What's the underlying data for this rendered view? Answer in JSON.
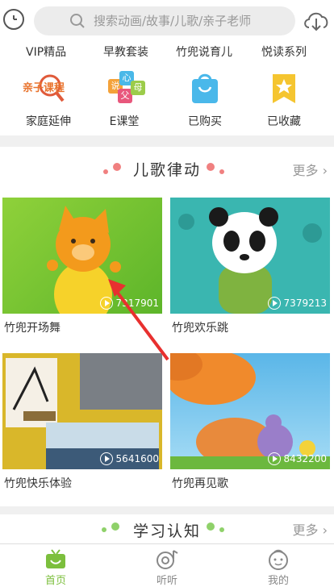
{
  "header": {
    "search_placeholder": "搜索动画/故事/儿歌/亲子老师"
  },
  "menu_top": [
    "VIP精品",
    "早教套装",
    "竹兜说育儿",
    "悦读系列"
  ],
  "icon_menu": [
    {
      "label": "家庭延伸",
      "icon": "parent-course-icon",
      "badge_text": "亲子课程"
    },
    {
      "label": "E课堂",
      "icon": "e-classroom-icon",
      "badge_chars": [
        "说",
        "心",
        "父",
        "母"
      ]
    },
    {
      "label": "已购买",
      "icon": "shopping-bag-icon"
    },
    {
      "label": "已收藏",
      "icon": "favorite-star-icon"
    }
  ],
  "sections": [
    {
      "title": "儿歌律动",
      "more_label": "更多",
      "dot_color": "#f08080",
      "items": [
        {
          "title": "竹兜开场舞",
          "play_count": "7317901"
        },
        {
          "title": "竹兜欢乐跳",
          "play_count": "7379213"
        },
        {
          "title": "竹兜快乐体验",
          "play_count": "5641600"
        },
        {
          "title": "竹兜再见歌",
          "play_count": "8432200"
        }
      ]
    },
    {
      "title": "学习认知",
      "more_label": "更多",
      "dot_color": "#8fd16a"
    }
  ],
  "tabbar": [
    {
      "label": "首页",
      "icon": "home-tv-icon",
      "active": true
    },
    {
      "label": "听听",
      "icon": "listen-icon",
      "active": false
    },
    {
      "label": "我的",
      "icon": "profile-face-icon",
      "active": false
    }
  ],
  "colors": {
    "accent_green": "#7cbf3d",
    "search_bg": "#ececec"
  }
}
